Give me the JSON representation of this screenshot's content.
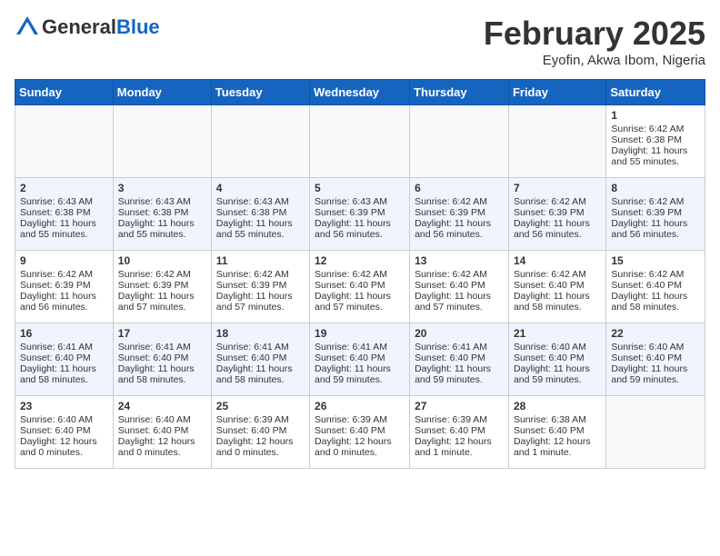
{
  "header": {
    "logo_general": "General",
    "logo_blue": "Blue",
    "month_title": "February 2025",
    "location": "Eyofin, Akwa Ibom, Nigeria"
  },
  "weekdays": [
    "Sunday",
    "Monday",
    "Tuesday",
    "Wednesday",
    "Thursday",
    "Friday",
    "Saturday"
  ],
  "weeks": [
    [
      {
        "day": "",
        "empty": true
      },
      {
        "day": "",
        "empty": true
      },
      {
        "day": "",
        "empty": true
      },
      {
        "day": "",
        "empty": true
      },
      {
        "day": "",
        "empty": true
      },
      {
        "day": "",
        "empty": true
      },
      {
        "day": "1",
        "sunrise": "6:42 AM",
        "sunset": "6:38 PM",
        "daylight": "11 hours and 55 minutes."
      }
    ],
    [
      {
        "day": "2",
        "sunrise": "6:43 AM",
        "sunset": "6:38 PM",
        "daylight": "11 hours and 55 minutes."
      },
      {
        "day": "3",
        "sunrise": "6:43 AM",
        "sunset": "6:38 PM",
        "daylight": "11 hours and 55 minutes."
      },
      {
        "day": "4",
        "sunrise": "6:43 AM",
        "sunset": "6:38 PM",
        "daylight": "11 hours and 55 minutes."
      },
      {
        "day": "5",
        "sunrise": "6:43 AM",
        "sunset": "6:39 PM",
        "daylight": "11 hours and 56 minutes."
      },
      {
        "day": "6",
        "sunrise": "6:42 AM",
        "sunset": "6:39 PM",
        "daylight": "11 hours and 56 minutes."
      },
      {
        "day": "7",
        "sunrise": "6:42 AM",
        "sunset": "6:39 PM",
        "daylight": "11 hours and 56 minutes."
      },
      {
        "day": "8",
        "sunrise": "6:42 AM",
        "sunset": "6:39 PM",
        "daylight": "11 hours and 56 minutes."
      }
    ],
    [
      {
        "day": "9",
        "sunrise": "6:42 AM",
        "sunset": "6:39 PM",
        "daylight": "11 hours and 56 minutes."
      },
      {
        "day": "10",
        "sunrise": "6:42 AM",
        "sunset": "6:39 PM",
        "daylight": "11 hours and 57 minutes."
      },
      {
        "day": "11",
        "sunrise": "6:42 AM",
        "sunset": "6:39 PM",
        "daylight": "11 hours and 57 minutes."
      },
      {
        "day": "12",
        "sunrise": "6:42 AM",
        "sunset": "6:40 PM",
        "daylight": "11 hours and 57 minutes."
      },
      {
        "day": "13",
        "sunrise": "6:42 AM",
        "sunset": "6:40 PM",
        "daylight": "11 hours and 57 minutes."
      },
      {
        "day": "14",
        "sunrise": "6:42 AM",
        "sunset": "6:40 PM",
        "daylight": "11 hours and 58 minutes."
      },
      {
        "day": "15",
        "sunrise": "6:42 AM",
        "sunset": "6:40 PM",
        "daylight": "11 hours and 58 minutes."
      }
    ],
    [
      {
        "day": "16",
        "sunrise": "6:41 AM",
        "sunset": "6:40 PM",
        "daylight": "11 hours and 58 minutes."
      },
      {
        "day": "17",
        "sunrise": "6:41 AM",
        "sunset": "6:40 PM",
        "daylight": "11 hours and 58 minutes."
      },
      {
        "day": "18",
        "sunrise": "6:41 AM",
        "sunset": "6:40 PM",
        "daylight": "11 hours and 58 minutes."
      },
      {
        "day": "19",
        "sunrise": "6:41 AM",
        "sunset": "6:40 PM",
        "daylight": "11 hours and 59 minutes."
      },
      {
        "day": "20",
        "sunrise": "6:41 AM",
        "sunset": "6:40 PM",
        "daylight": "11 hours and 59 minutes."
      },
      {
        "day": "21",
        "sunrise": "6:40 AM",
        "sunset": "6:40 PM",
        "daylight": "11 hours and 59 minutes."
      },
      {
        "day": "22",
        "sunrise": "6:40 AM",
        "sunset": "6:40 PM",
        "daylight": "11 hours and 59 minutes."
      }
    ],
    [
      {
        "day": "23",
        "sunrise": "6:40 AM",
        "sunset": "6:40 PM",
        "daylight": "12 hours and 0 minutes."
      },
      {
        "day": "24",
        "sunrise": "6:40 AM",
        "sunset": "6:40 PM",
        "daylight": "12 hours and 0 minutes."
      },
      {
        "day": "25",
        "sunrise": "6:39 AM",
        "sunset": "6:40 PM",
        "daylight": "12 hours and 0 minutes."
      },
      {
        "day": "26",
        "sunrise": "6:39 AM",
        "sunset": "6:40 PM",
        "daylight": "12 hours and 0 minutes."
      },
      {
        "day": "27",
        "sunrise": "6:39 AM",
        "sunset": "6:40 PM",
        "daylight": "12 hours and 1 minute."
      },
      {
        "day": "28",
        "sunrise": "6:38 AM",
        "sunset": "6:40 PM",
        "daylight": "12 hours and 1 minute."
      },
      {
        "day": "",
        "empty": true
      }
    ]
  ]
}
